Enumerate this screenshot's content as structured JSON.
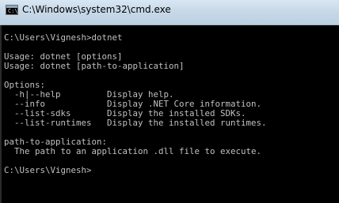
{
  "window": {
    "title": "C:\\Windows\\system32\\cmd.exe",
    "icon": "cmd-console-icon",
    "icon_prompt": "C:\\"
  },
  "console": {
    "lines": [
      "C:\\Users\\Vignesh>dotnet",
      "",
      "Usage: dotnet [options]",
      "Usage: dotnet [path-to-application]",
      "",
      "Options:",
      "  -h|--help         Display help.",
      "  --info            Display .NET Core information.",
      "  --list-sdks       Display the installed SDKs.",
      "  --list-runtimes   Display the installed runtimes.",
      "",
      "path-to-application:",
      "  The path to an application .dll file to execute.",
      "",
      "C:\\Users\\Vignesh>"
    ]
  },
  "colors": {
    "console_background": "#000000",
    "console_text": "#c0c0c0",
    "titlebar": "#c8d9e8"
  }
}
